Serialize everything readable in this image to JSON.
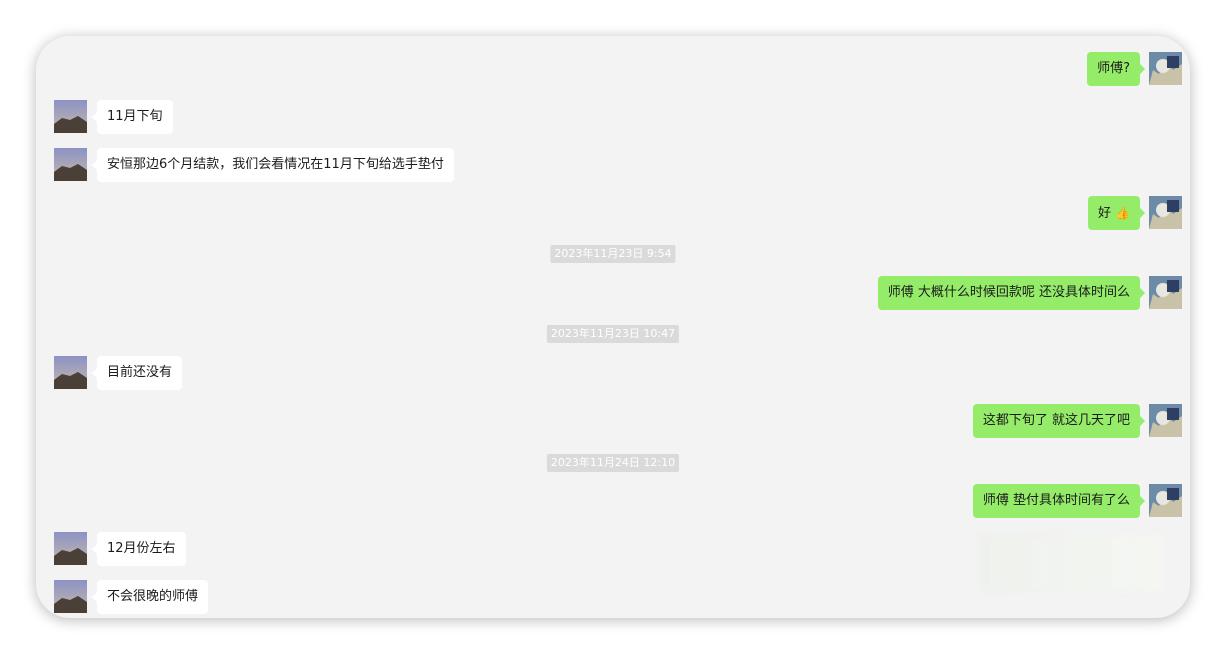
{
  "messages": [
    {
      "side": "right",
      "type": "text",
      "text": "师傅?"
    },
    {
      "side": "left",
      "type": "text",
      "text": "11月下旬"
    },
    {
      "side": "left",
      "type": "text",
      "text": "安恒那边6个月结款，我们会看情况在11月下旬给选手垫付"
    },
    {
      "side": "right",
      "type": "text",
      "text": "好",
      "emoji": "thumbs-up-icon"
    },
    {
      "type": "timestamp",
      "text": "2023年11月23日 9:54"
    },
    {
      "side": "right",
      "type": "text",
      "text": "师傅 大概什么时候回款呢 还没具体时间么"
    },
    {
      "type": "timestamp",
      "text": "2023年11月23日 10:47"
    },
    {
      "side": "left",
      "type": "text",
      "text": "目前还没有"
    },
    {
      "side": "right",
      "type": "text",
      "text": "这都下旬了 就这几天了吧"
    },
    {
      "type": "timestamp",
      "text": "2023年11月24日 12:10"
    },
    {
      "side": "right",
      "type": "text",
      "text": "师傅 垫付具体时间有了么"
    },
    {
      "side": "left",
      "type": "text",
      "text": "12月份左右"
    },
    {
      "side": "left",
      "type": "text",
      "text": "不会很晚的师傅"
    }
  ],
  "colors": {
    "panel_background": "#f3f3f3",
    "sent_bubble": "#95ec69",
    "received_bubble": "#ffffff",
    "timestamp_background": "#dadada"
  }
}
